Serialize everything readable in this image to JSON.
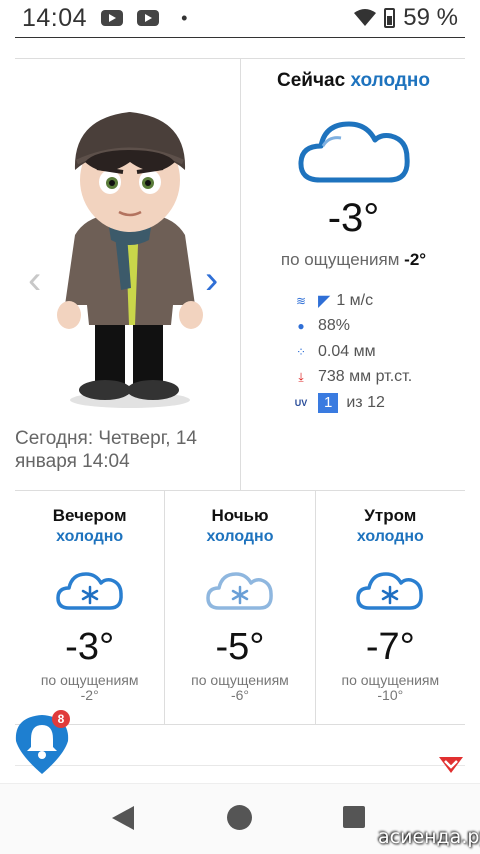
{
  "status": {
    "time": "14:04",
    "battery": "59 %",
    "icons": [
      "youtube-icon",
      "youtube-icon",
      "dot-icon",
      "wifi-icon",
      "battery-icon"
    ]
  },
  "now": {
    "title": "Сейчас",
    "condition": "холодно",
    "temp": "-3°",
    "feels_label": "по ощущениям",
    "feels_value": "-2°",
    "wind": "1 м/с",
    "humidity": "88%",
    "precip": "0.04 мм",
    "pressure": "738 мм рт.ст.",
    "uv_label": "UV",
    "uv_value": "1",
    "uv_max": "из 12",
    "today": "Сегодня: Четверг, 14 января 14:04"
  },
  "forecast": [
    {
      "title": "Вечером",
      "condition": "холодно",
      "temp": "-3°",
      "feels_label": "по ощущениям",
      "feels_value": "-2°"
    },
    {
      "title": "Ночью",
      "condition": "холодно",
      "temp": "-5°",
      "feels_label": "по ощущениям",
      "feels_value": "-6°"
    },
    {
      "title": "Утром",
      "condition": "холодно",
      "temp": "-7°",
      "feels_label": "по ощущениям",
      "feels_value": "-10°"
    }
  ],
  "notifications": {
    "count": "8"
  },
  "watermark": "асиенда.ру",
  "colors": {
    "accent": "#1e73be",
    "uv": "#3a7be0",
    "badge": "#e03b3b"
  }
}
